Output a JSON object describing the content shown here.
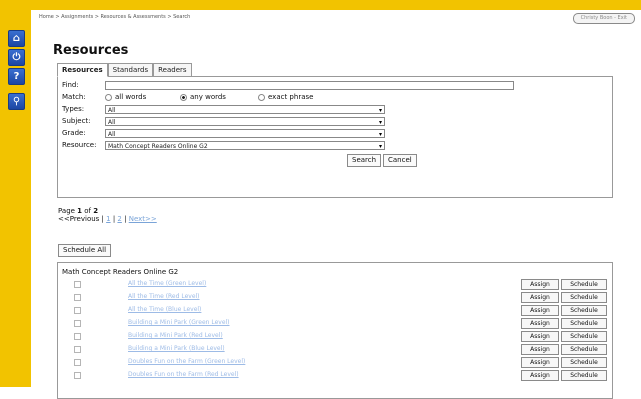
{
  "breadcrumb": "Home > Assignments > Resources & Assessments > Search",
  "user": "Christy Boon - Exit",
  "sidebar": {
    "icons": [
      "home-icon",
      "power-icon",
      "help-icon",
      "search-icon"
    ]
  },
  "page_title": "Resources",
  "tabs": [
    "Resources",
    "Standards",
    "Readers"
  ],
  "search": {
    "find_label": "Find:",
    "find_value": "",
    "match_label": "Match:",
    "match_options": [
      "all words",
      "any words",
      "exact phrase"
    ],
    "match_selected": "any words",
    "types_label": "Types:",
    "types_value": "All",
    "subject_label": "Subject:",
    "subject_value": "All",
    "grade_label": "Grade:",
    "grade_value": "All",
    "resource_label": "Resource:",
    "resource_value": "Math Concept Readers Online G2",
    "search_button": "Search",
    "cancel_button": "Cancel"
  },
  "pagination": {
    "prefix": "Page ",
    "current": "1",
    "sep": " of ",
    "total": "2",
    "prev": "<<Previous",
    "bar": " | ",
    "page1": "1",
    "page2": "2",
    "next": "Next>>"
  },
  "schedule_all": "Schedule All",
  "results": {
    "heading": "Math Concept Readers Online G2",
    "assign_label": "Assign",
    "schedule_label": "Schedule",
    "items": [
      "All the Time (Green Level)",
      "All the Time (Red Level)",
      "All the Time (Blue Level)",
      "Building a Mini Park (Green Level)",
      "Building a Mini Park (Red Level)",
      "Building a Mini Park (Blue Level)",
      "Doubles Fun on the Farm (Green Level)",
      "Doubles Fun on the Farm (Red Level)"
    ]
  }
}
